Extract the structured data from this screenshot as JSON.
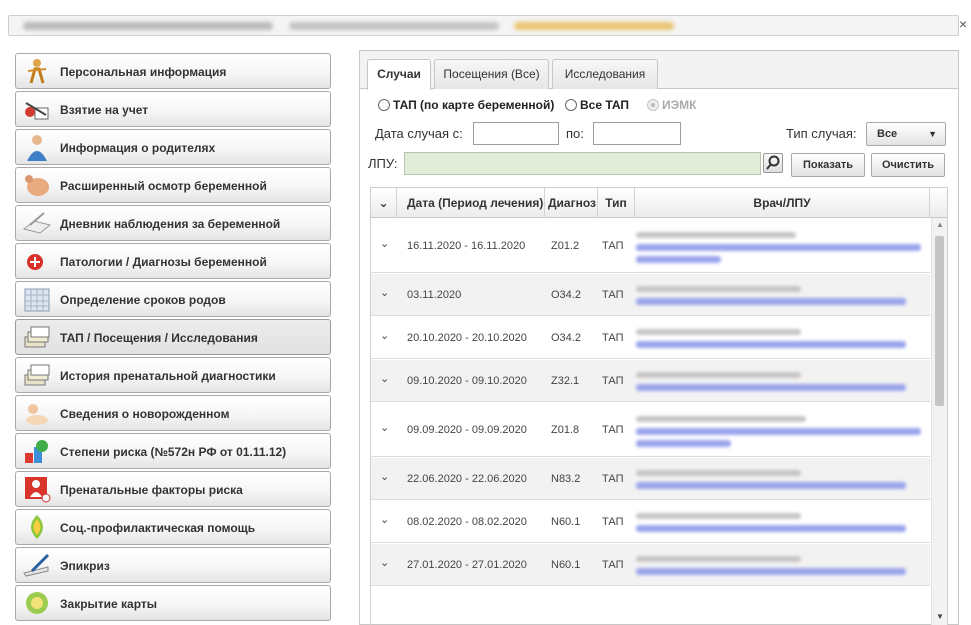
{
  "colors": {
    "accent_blue": "#9aa4ec",
    "lpu_field": "#e1ecd9",
    "sidebar_border": "#a9a9a9"
  },
  "titlebar": {
    "close_icon": "close-icon"
  },
  "sidebar": {
    "items": [
      {
        "label": "Персональная информация",
        "icon": "person-icon"
      },
      {
        "label": "Взятие на учет",
        "icon": "register-icon"
      },
      {
        "label": "Информация о родителях",
        "icon": "parents-icon"
      },
      {
        "label": "Расширенный осмотр беременной",
        "icon": "pregnant-icon"
      },
      {
        "label": "Дневник наблюдения за беременной",
        "icon": "diary-icon"
      },
      {
        "label": "Патологии / Диагнозы беременной",
        "icon": "pathology-icon"
      },
      {
        "label": "Определение сроков родов",
        "icon": "calendar-icon"
      },
      {
        "label": "ТАП / Посещения / Исследования",
        "icon": "files-icon"
      },
      {
        "label": "История пренатальной диагностики",
        "icon": "files-icon"
      },
      {
        "label": "Сведения о новорожденном",
        "icon": "newborn-icon"
      },
      {
        "label": "Степени риска (№572н РФ от 01.11.12)",
        "icon": "risk-icon"
      },
      {
        "label": "Пренатальные факторы риска",
        "icon": "risk-factors-icon"
      },
      {
        "label": "Соц.-профилактическая помощь",
        "icon": "social-icon"
      },
      {
        "label": "Эпикриз",
        "icon": "pen-icon"
      },
      {
        "label": "Закрытие карты",
        "icon": "close-card-icon"
      }
    ]
  },
  "tabs": [
    "Случаи",
    "Посещения (Все)",
    "Исследования"
  ],
  "filters": {
    "radio1": "ТАП (по карте беременной)",
    "radio2": "Все ТАП",
    "radio3": "ИЭМК",
    "date_from_label": "Дата случая с:",
    "date_to_label": "по:",
    "case_type_label": "Тип случая:",
    "case_type_value": "Все",
    "lpu_label": "ЛПУ:",
    "show_button": "Показать",
    "clear_button": "Очистить"
  },
  "grid": {
    "columns": [
      "Дата (Период лечения)",
      "Диагноз",
      "Тип",
      "Врач/ЛПУ"
    ],
    "rows": [
      {
        "period": "16.11.2020 - 16.11.2020",
        "diagnosis": "Z01.2",
        "type": "ТАП"
      },
      {
        "period": "03.11.2020",
        "diagnosis": "O34.2",
        "type": "ТАП"
      },
      {
        "period": "20.10.2020 - 20.10.2020",
        "diagnosis": "O34.2",
        "type": "ТАП"
      },
      {
        "period": "09.10.2020 - 09.10.2020",
        "diagnosis": "Z32.1",
        "type": "ТАП"
      },
      {
        "period": "09.09.2020 - 09.09.2020",
        "diagnosis": "Z01.8",
        "type": "ТАП"
      },
      {
        "period": "22.06.2020 - 22.06.2020",
        "diagnosis": "N83.2",
        "type": "ТАП"
      },
      {
        "period": "08.02.2020 - 08.02.2020",
        "diagnosis": "N60.1",
        "type": "ТАП"
      },
      {
        "period": "27.01.2020 - 27.01.2020",
        "diagnosis": "N60.1",
        "type": "ТАП"
      }
    ]
  }
}
